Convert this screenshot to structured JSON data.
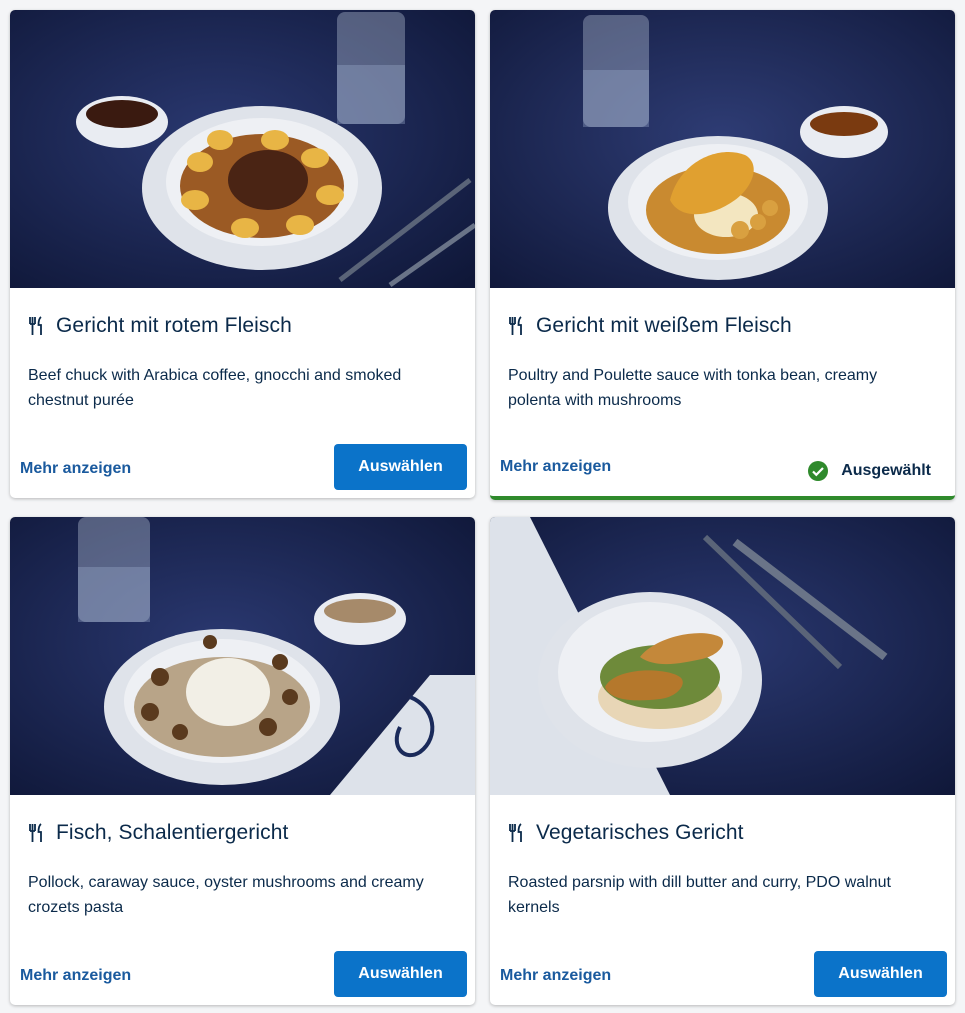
{
  "colors": {
    "primary_button": "#0b73c9",
    "link": "#1a5a9e",
    "text": "#0b2a4a",
    "selected_accent": "#2f8a2c",
    "photo_background": "#141e45"
  },
  "meals": [
    {
      "title": "Gericht mit rotem Fleisch",
      "description": "Beef chuck with Arabica coffee, gnocchi and smoked chestnut purée",
      "more_label": "Mehr anzeigen",
      "select_label": "Auswählen",
      "icon": "cutlery-icon"
    },
    {
      "title": "Gericht mit weißem Fleisch",
      "description": "Poultry and Poulette sauce with tonka bean, creamy polenta with mushrooms",
      "more_label": "Mehr anzeigen",
      "selected_label": "Ausgewählt",
      "icon": "cutlery-icon"
    },
    {
      "title": "Fisch, Schalentiergericht",
      "description": "Pollock, caraway sauce, oyster mushrooms and creamy crozets pasta",
      "more_label": "Mehr anzeigen",
      "select_label": "Auswählen",
      "icon": "cutlery-icon"
    },
    {
      "title": "Vegetarisches Gericht",
      "description": "Roasted parsnip with dill butter and curry, PDO walnut kernels",
      "more_label": "Mehr anzeigen",
      "select_label": "Auswählen",
      "icon": "cutlery-icon"
    }
  ]
}
